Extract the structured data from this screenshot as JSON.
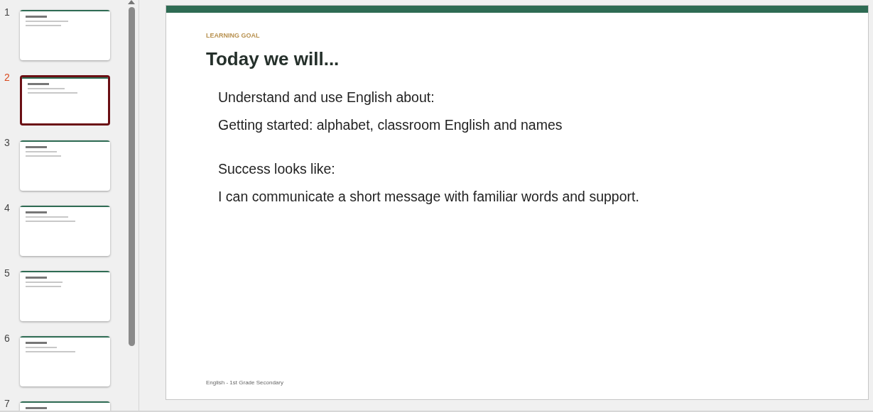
{
  "thumbnails": [
    {
      "number": "1",
      "selected": false
    },
    {
      "number": "2",
      "selected": true
    },
    {
      "number": "3",
      "selected": false
    },
    {
      "number": "4",
      "selected": false
    },
    {
      "number": "5",
      "selected": false
    },
    {
      "number": "6",
      "selected": false
    },
    {
      "number": "7",
      "selected": false
    }
  ],
  "slide": {
    "eyebrow": "LEARNING GOAL",
    "title": "Today we will...",
    "sections": [
      {
        "lines": [
          "Understand and use English about:",
          "Getting started: alphabet, classroom English and names"
        ]
      },
      {
        "lines": [
          "Success looks like:",
          "I can communicate a short message with familiar words and support."
        ]
      }
    ],
    "footer": "English - 1st Grade Secondary"
  }
}
